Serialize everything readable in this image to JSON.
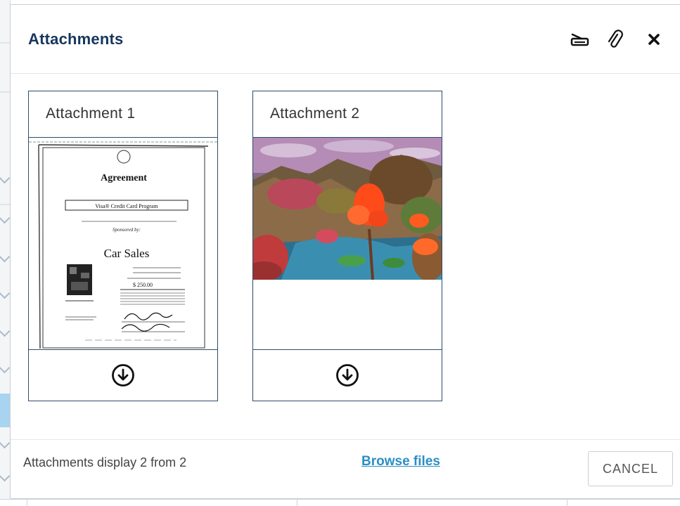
{
  "dialog": {
    "title": "Attachments",
    "header_icons": [
      "scanner-icon",
      "paperclip-icon",
      "close-icon"
    ]
  },
  "attachments": [
    {
      "title": "Attachment 1",
      "preview": {
        "heading": "Agreement",
        "program": "Visa® Credit Card Program",
        "sponsored": "Sponsored by:",
        "company": "Car Sales",
        "amount": "$ 250.00"
      },
      "download_icon": "download-circle-icon"
    },
    {
      "title": "Attachment 2",
      "download_icon": "download-circle-icon"
    }
  ],
  "footer": {
    "count_text": "Attachments display 2 from 2",
    "browse_label": "Browse files",
    "cancel_label": "CANCEL"
  },
  "colors": {
    "title": "#17365d",
    "card_border": "#2f4b6b",
    "link": "#2a8fc4"
  }
}
